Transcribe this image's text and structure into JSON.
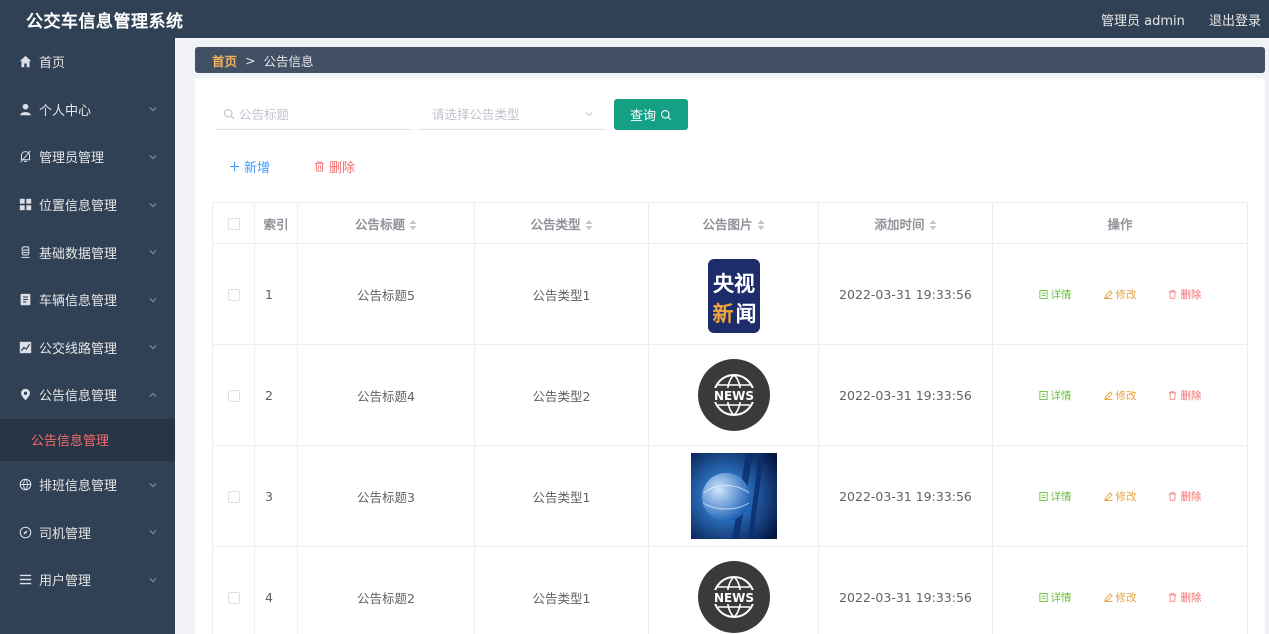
{
  "app": {
    "title": "公交车信息管理系统",
    "user": "管理员 admin",
    "logout": "退出登录"
  },
  "sidebar": {
    "items": [
      {
        "label": "首页",
        "icon": "home-icon"
      },
      {
        "label": "个人中心",
        "icon": "user-icon"
      },
      {
        "label": "管理员管理",
        "icon": "bell-icon"
      },
      {
        "label": "位置信息管理",
        "icon": "grid-icon"
      },
      {
        "label": "基础数据管理",
        "icon": "database-icon"
      },
      {
        "label": "车辆信息管理",
        "icon": "document-icon"
      },
      {
        "label": "公交线路管理",
        "icon": "chart-icon"
      },
      {
        "label": "公告信息管理",
        "icon": "location-icon"
      },
      {
        "label": "排班信息管理",
        "icon": "globe-icon"
      },
      {
        "label": "司机管理",
        "icon": "compass-icon"
      },
      {
        "label": "用户管理",
        "icon": "list-icon"
      }
    ],
    "active_sub": "公告信息管理"
  },
  "breadcrumb": {
    "home": "首页",
    "separator": ">",
    "current": "公告信息"
  },
  "search": {
    "title_placeholder": "公告标题",
    "type_placeholder": "请选择公告类型",
    "query_label": "查询"
  },
  "actions": {
    "add_label": "新增",
    "delete_label": "删除"
  },
  "table": {
    "headers": {
      "index": "索引",
      "title": "公告标题",
      "type": "公告类型",
      "image": "公告图片",
      "time": "添加时间",
      "ops": "操作"
    },
    "rows": [
      {
        "index": "1",
        "title": "公告标题5",
        "type": "公告类型1",
        "image": "cctv-news-logo",
        "time": "2022-03-31 19:33:56"
      },
      {
        "index": "2",
        "title": "公告标题4",
        "type": "公告类型2",
        "image": "news-globe-badge",
        "time": "2022-03-31 19:33:56"
      },
      {
        "index": "3",
        "title": "公告标题3",
        "type": "公告类型1",
        "image": "blue-globe-photo",
        "time": "2022-03-31 19:33:56"
      },
      {
        "index": "4",
        "title": "公告标题2",
        "type": "公告类型1",
        "image": "news-globe-badge",
        "time": "2022-03-31 19:33:56"
      }
    ],
    "ops": {
      "detail": "详情",
      "edit": "修改",
      "delete": "删除"
    }
  },
  "colors": {
    "sidebar_bg": "#304156",
    "accent_green": "#13a085",
    "danger": "#f56c6c",
    "primary": "#409eff",
    "warning": "#e6a23c",
    "success": "#67c23a"
  },
  "logo_text": {
    "cctv_line1": "央视",
    "cctv_line2_a": "新",
    "cctv_line2_b": "闻",
    "badge": "NEWS"
  }
}
